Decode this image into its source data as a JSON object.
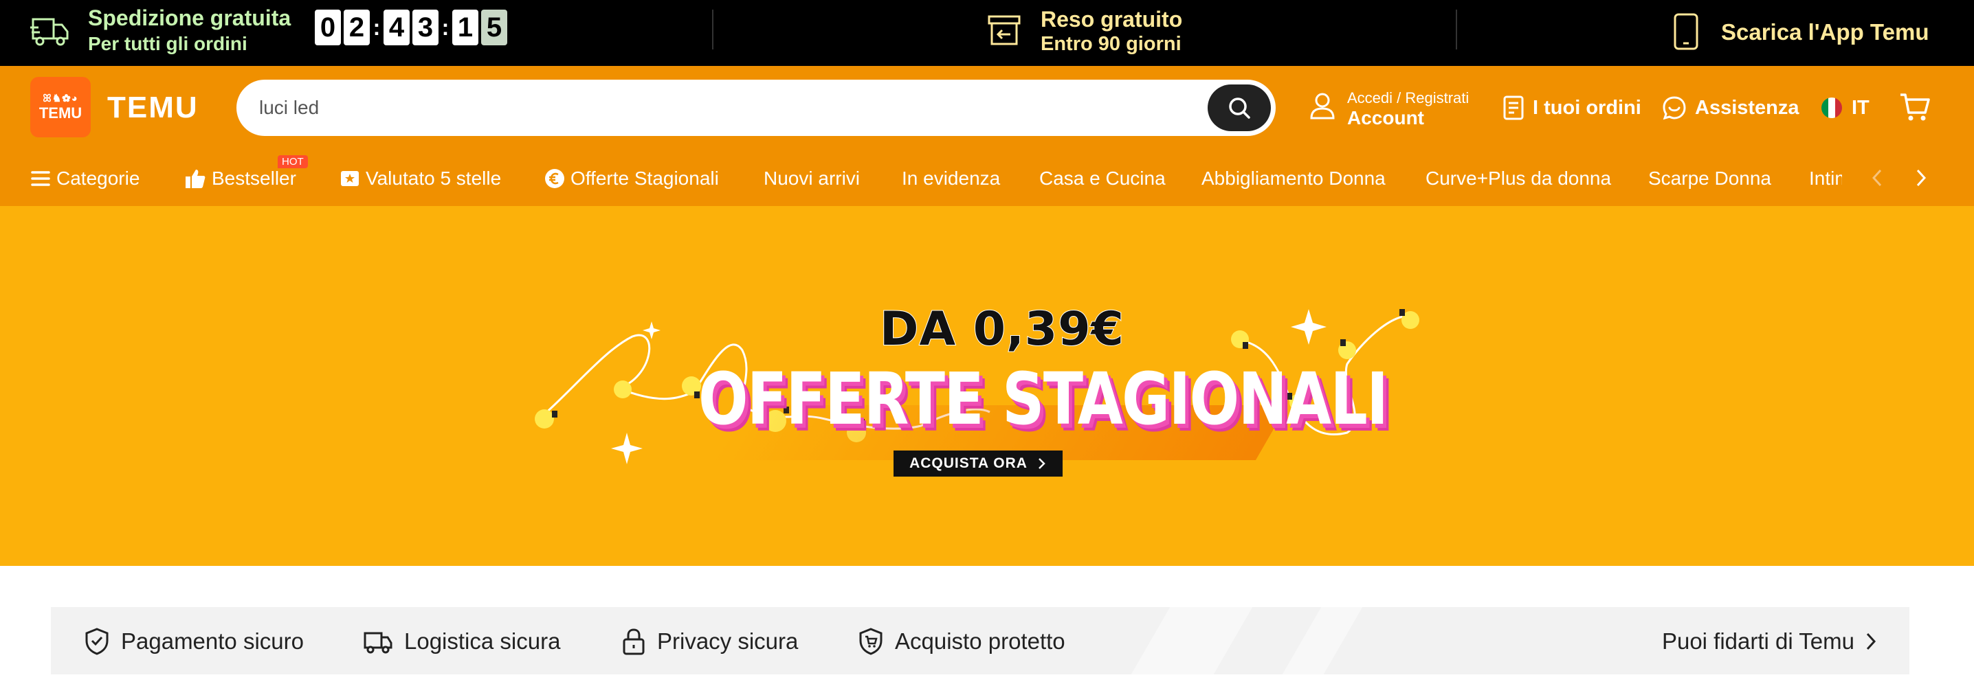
{
  "promo_bar": {
    "shipping_title": "Spedizione gratuita",
    "shipping_sub": "Per tutti gli ordini",
    "countdown_digits": [
      "0",
      "2",
      "4",
      "3",
      "1",
      "5"
    ],
    "return_title": "Reso gratuito",
    "return_sub": "Entro 90 giorni",
    "app_text": "Scarica l'App Temu",
    "colors": {
      "shipping": "#c6f3b0",
      "return": "#ffe89a",
      "background": "#000000"
    }
  },
  "header": {
    "logo_icons": "ꕤ♞✿◕",
    "logo_small": "TEMU",
    "logo_word": "TEMU",
    "search": {
      "value": "",
      "placeholder": "luci led"
    },
    "account": {
      "top": "Accedi / Registrati",
      "main": "Account"
    },
    "orders_label": "I tuoi ordini",
    "support_label": "Assistenza",
    "language": "IT",
    "colors": {
      "bar": "#f09000",
      "logo": "#ff6a13"
    },
    "icons": [
      "search-icon",
      "user-icon",
      "orders-icon",
      "support-icon",
      "italy-flag-icon",
      "cart-icon"
    ]
  },
  "categories": {
    "items": [
      {
        "label": "Categorie"
      },
      {
        "label": "Bestseller",
        "badge": "HOT"
      },
      {
        "label": "Valutato 5 stelle"
      },
      {
        "label": "Offerte Stagionali"
      },
      {
        "label": "Nuovi arrivi"
      },
      {
        "label": "In evidenza"
      },
      {
        "label": "Casa e Cucina"
      },
      {
        "label": "Abbigliamento Donna"
      },
      {
        "label": "Curve+Plus da donna"
      },
      {
        "label": "Scarpe Donna"
      },
      {
        "label": "Intim"
      }
    ],
    "icons": [
      "menu-icon",
      "thumbs-up-icon",
      "star-badge-icon",
      "euro-icon",
      "chevron-left-icon",
      "chevron-right-icon"
    ]
  },
  "hero": {
    "price": "DA 0,39€",
    "title": "OFFERTE STAGIONALI",
    "cta": "ACQUISTA ORA",
    "colors": {
      "background": "#fcb10a",
      "title_shadow": "#f04fb4"
    }
  },
  "trust": {
    "items": [
      {
        "label": "Pagamento sicuro",
        "icon": "shield-check-icon"
      },
      {
        "label": "Logistica sicura",
        "icon": "truck-icon"
      },
      {
        "label": "Privacy sicura",
        "icon": "lock-icon"
      },
      {
        "label": "Acquisto protetto",
        "icon": "shield-cart-icon"
      }
    ],
    "link": "Puoi fidarti di Temu"
  }
}
